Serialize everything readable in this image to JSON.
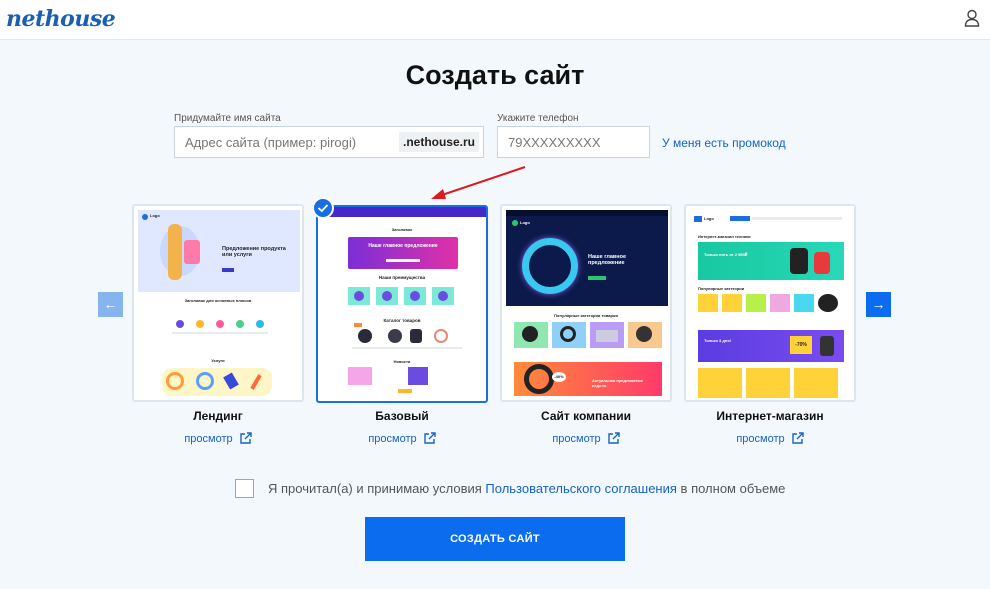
{
  "header": {
    "logo": "nethouse"
  },
  "page": {
    "title": "Создать сайт"
  },
  "form": {
    "name_label": "Придумайте имя сайта",
    "name_placeholder": "Адрес сайта (пример: pirogi)",
    "domain_suffix": ".nethouse.ru",
    "phone_label": "Укажите телефон",
    "phone_placeholder": "79XXXXXXXXX",
    "promo_link": "У меня есть промокод"
  },
  "templates": [
    {
      "name": "Лендинг",
      "preview": "просмотр",
      "selected": false
    },
    {
      "name": "Базовый",
      "preview": "просмотр",
      "selected": true
    },
    {
      "name": "Сайт компании",
      "preview": "просмотр",
      "selected": false
    },
    {
      "name": "Интернет-магазин",
      "preview": "просмотр",
      "selected": false
    }
  ],
  "thumbnails": {
    "landing": {
      "logo": "Logo",
      "hero": "Предложение продукта или услуги",
      "benefits": "Заголовок для основных плюсов",
      "section": "Услуги"
    },
    "basic": {
      "header": "Заголовок",
      "banner": "Наше главное предложение",
      "advantages": "Наши преимущества",
      "catalog": "Каталог товаров",
      "news": "Новости"
    },
    "company": {
      "logo": "Logo",
      "hero": "Наше главное предложение",
      "categories": "Популярные категории товаров",
      "discount": "-40%",
      "promo": "Актуальная предложение недели"
    },
    "shop": {
      "logo": "Logo",
      "title": "Интернет-магазин техники",
      "banner": "Только пять от 2 990₽",
      "popular": "Популярные категории",
      "discount": "-70%",
      "offer": "Только 3 дня!"
    }
  },
  "agreement": {
    "prefix": "Я прочитал(а) и принимаю условия",
    "link": "Пользовательского соглашения",
    "suffix": "в полном объеме"
  },
  "submit_label": "СОЗДАТЬ САЙТ",
  "colors": {
    "accent": "#0b6cf0",
    "link": "#1463c7",
    "annotation": "#e0191f"
  }
}
